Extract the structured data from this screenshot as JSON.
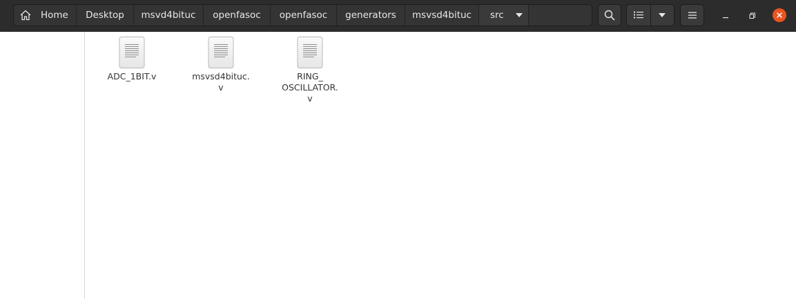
{
  "breadcrumb": {
    "items": [
      {
        "label": "Home"
      },
      {
        "label": "Desktop"
      },
      {
        "label": "msvd4bituc"
      },
      {
        "label": "openfasoc"
      },
      {
        "label": "openfasoc"
      },
      {
        "label": "generators"
      },
      {
        "label": "msvsd4bituc"
      },
      {
        "label": "src"
      }
    ]
  },
  "toolbar": {
    "search_icon": "search-icon",
    "list_view_icon": "list-view-icon",
    "view_options_icon": "chevron-down-icon",
    "menu_icon": "hamburger-menu-icon"
  },
  "window_controls": {
    "minimize_icon": "minimize-icon",
    "restore_icon": "restore-icon",
    "close_icon": "close-icon",
    "close_color": "#e95420"
  },
  "files": [
    {
      "name": "ADC_1BIT.v",
      "icon": "text-file-icon"
    },
    {
      "name": "msvsd4bituc.\nv",
      "icon": "text-file-icon"
    },
    {
      "name": "RING_\nOSCILLATOR.\nv",
      "icon": "text-file-icon"
    }
  ],
  "colors": {
    "headerbar": "#2c2c2c",
    "accent": "#e95420",
    "background": "#ffffff"
  }
}
